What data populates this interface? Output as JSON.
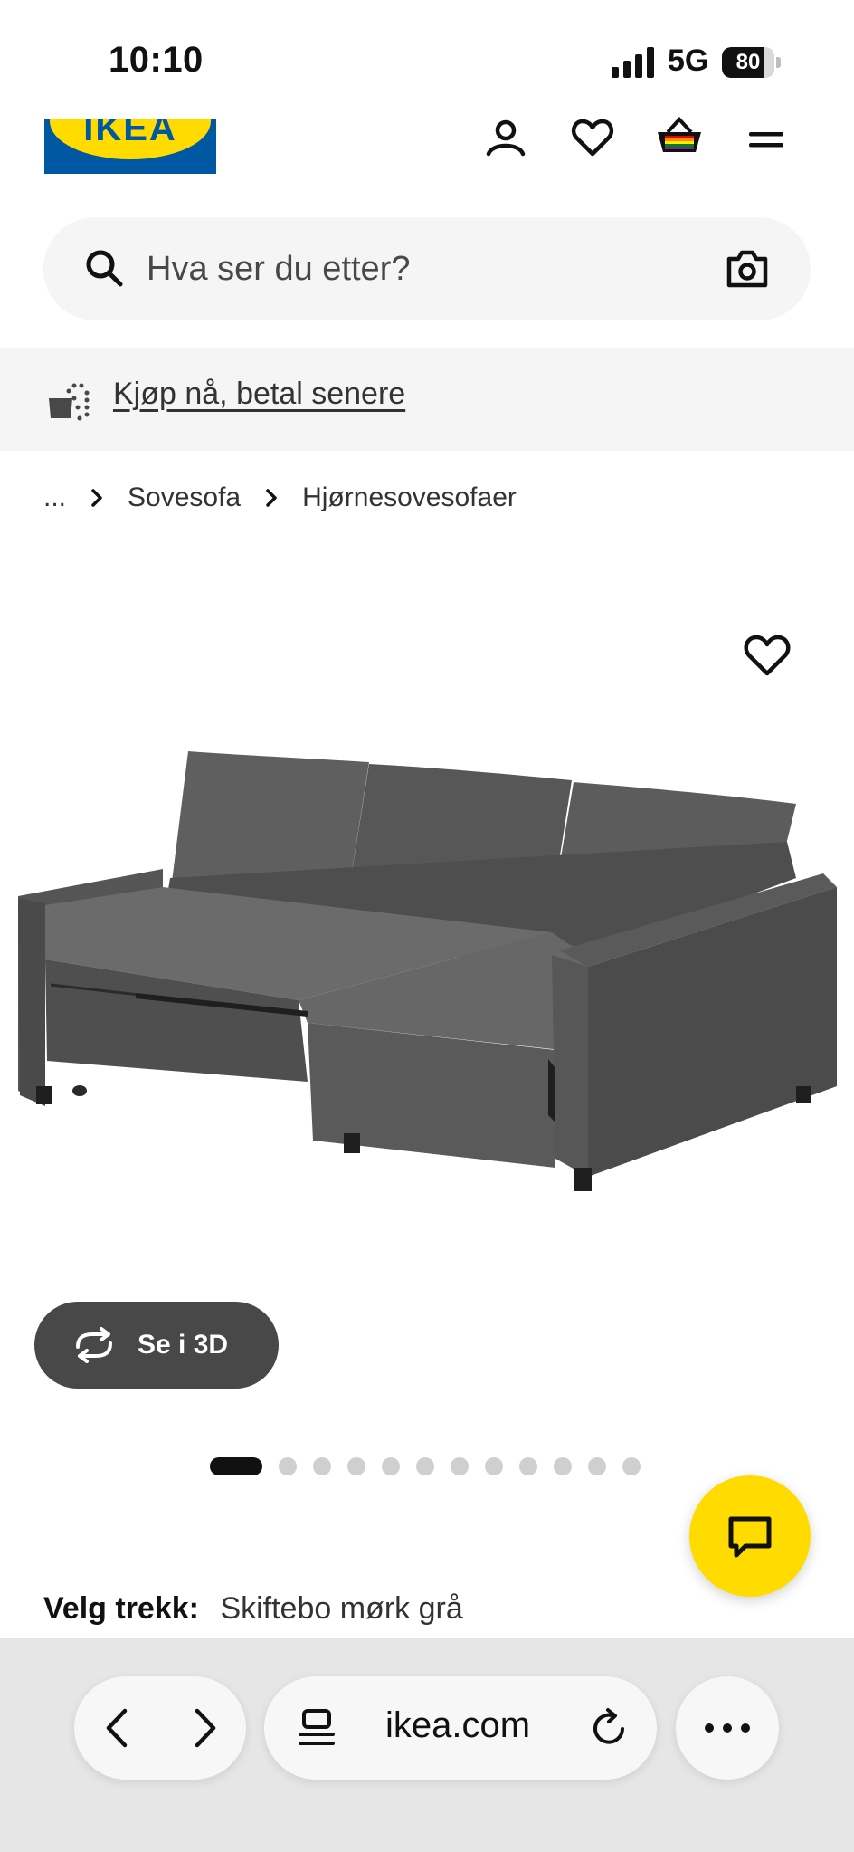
{
  "status_bar": {
    "time": "10:10",
    "network": "5G",
    "battery_percent": 80,
    "battery_label": "80"
  },
  "header": {
    "logo_text": "IKEA",
    "brand_colors": {
      "blue": "#0058a3",
      "yellow": "#ffdb00"
    },
    "icons": [
      "account-icon",
      "heart-icon",
      "shopping-basket-icon",
      "menu-icon"
    ]
  },
  "search": {
    "placeholder": "Hva ser du etter?",
    "value": ""
  },
  "promo": {
    "link_text": "Kjøp nå, betal senere"
  },
  "breadcrumb": {
    "items": [
      "...",
      "Sovesofa",
      "Hjørnesovesofaer"
    ]
  },
  "product_image": {
    "button_3d_label": "Se i 3D",
    "carousel": {
      "total": 12,
      "active_index": 0
    }
  },
  "cover": {
    "label": "Velg trekk:",
    "value": "Skiftebo mørk grå"
  },
  "browser": {
    "url": "ikea.com"
  }
}
